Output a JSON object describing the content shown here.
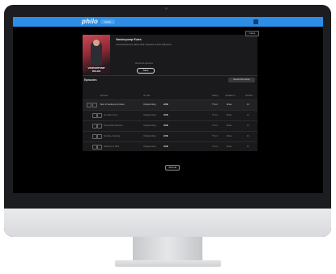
{
  "app": {
    "logo": "philo",
    "nav_label": "Guide"
  },
  "modal": {
    "close_label": "Close",
    "show_title": "Vanderpump Rules",
    "description": "Lisa Vanderpump's staff at SUR restaurant in West Hollywood...",
    "poster_caption": "VANDERPUMP RULES",
    "save_label": "Record all episodes",
    "record_button": "Save"
  },
  "episodes": {
    "heading": "Episodes",
    "record_series": "Record this series",
    "columns": [
      "",
      "Episode",
      "Air date",
      "Rating",
      "Available in",
      "Duration"
    ],
    "rows": [
      {
        "title": "Best of Vanderpump Rules",
        "air": "Original Airing",
        "live": "LIVE",
        "rating": "TV-14",
        "avail": "Bravo",
        "dur": "1h"
      },
      {
        "title": "Jax Takes Over",
        "air": "Original Airing",
        "live": "LIVE",
        "rating": "TV-14",
        "avail": "Bravo",
        "dur": "1h"
      },
      {
        "title": "Pump Rules Reunion",
        "air": "Original Airing",
        "live": "LIVE",
        "rating": "TV-14",
        "avail": "Bravo",
        "dur": "1h"
      },
      {
        "title": "Surprise, Surprise",
        "air": "Original Airing",
        "live": "LIVE",
        "rating": "TV-14",
        "avail": "Bravo",
        "dur": "1h"
      },
      {
        "title": "Welcome to SUR",
        "air": "Original Airing",
        "live": "LIVE",
        "rating": "TV-14",
        "avail": "Bravo",
        "dur": "1h"
      }
    ],
    "load_more": "Show all"
  },
  "colors": {
    "topbar": "#2c8ee6",
    "panel": "#1a1a1c",
    "bezel": "#1c1d20"
  }
}
